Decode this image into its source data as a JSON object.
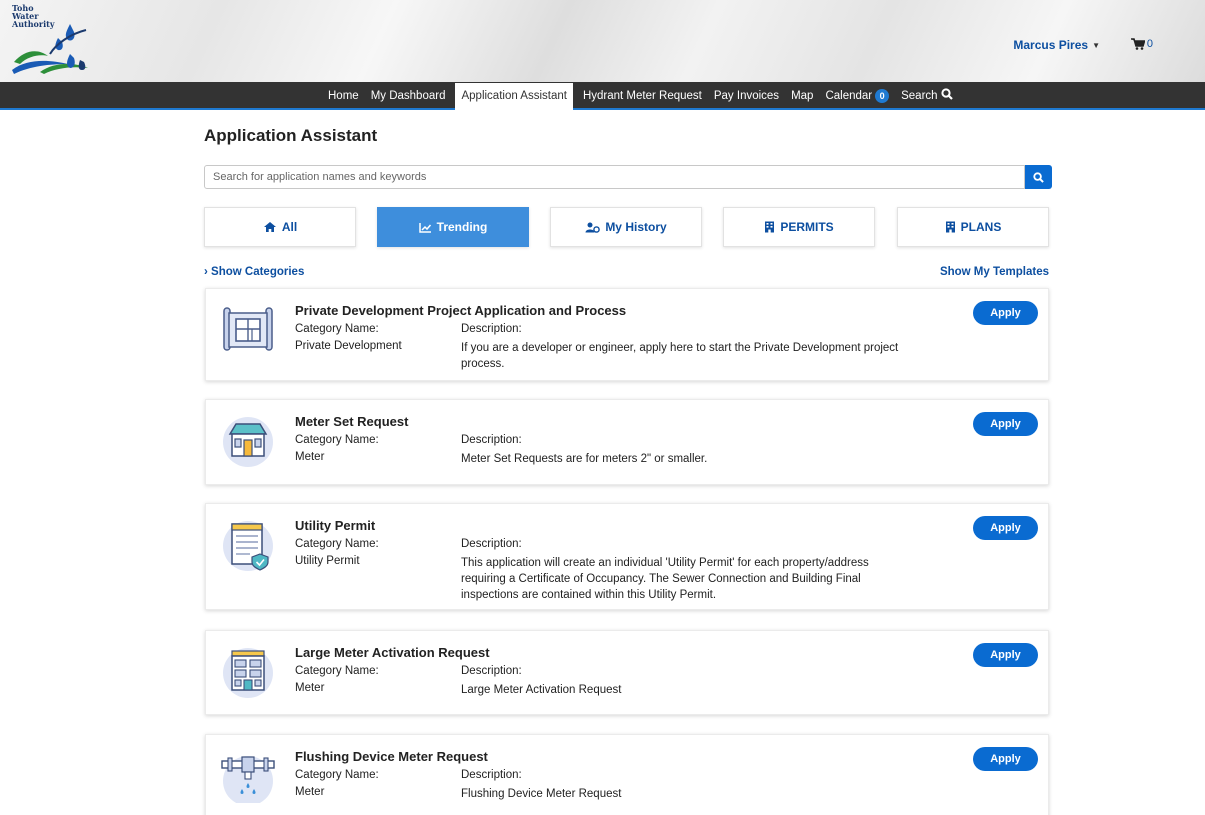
{
  "header": {
    "logo_text": [
      "Toho",
      "Water",
      "Authority"
    ],
    "user_name": "Marcus Pires",
    "cart_count": "0"
  },
  "nav": {
    "items": [
      {
        "label": "Home"
      },
      {
        "label": "My Dashboard"
      },
      {
        "label": "Application Assistant"
      },
      {
        "label": "Hydrant Meter Request"
      },
      {
        "label": "Pay Invoices"
      },
      {
        "label": "Map"
      },
      {
        "label": "Calendar"
      },
      {
        "label": "Search"
      }
    ],
    "calendar_badge": "0",
    "active": "Application Assistant"
  },
  "page": {
    "title": "Application Assistant",
    "search_placeholder": "Search for application names and keywords",
    "tabs": [
      {
        "label": "All",
        "icon": "home-icon"
      },
      {
        "label": "Trending",
        "icon": "chart-icon"
      },
      {
        "label": "My History",
        "icon": "users-icon"
      },
      {
        "label": "PERMITS",
        "icon": "building-icon"
      },
      {
        "label": "PLANS",
        "icon": "building-icon"
      }
    ],
    "active_tab": "Trending",
    "show_categories": "Show Categories",
    "show_templates": "Show My Templates"
  },
  "labels": {
    "category": "Category Name:",
    "description": "Description:",
    "apply": "Apply"
  },
  "applications": [
    {
      "title": "Private Development Project Application and Process",
      "category": "Private Development",
      "description": "If you are a developer or engineer, apply here to start the Private Development project process.",
      "icon": "blueprint-icon"
    },
    {
      "title": "Meter Set Request",
      "category": "Meter",
      "description": "Meter Set Requests are for meters 2\" or smaller.",
      "icon": "house-icon"
    },
    {
      "title": "Utility Permit",
      "category": "Utility Permit",
      "description": "This application will create an individual 'Utility Permit' for each property/address requiring a Certificate of Occupancy. The Sewer Connection and Building Final inspections are contained within this Utility Permit.",
      "icon": "document-check-icon"
    },
    {
      "title": "Large Meter Activation Request",
      "category": "Meter",
      "description": "Large Meter Activation Request",
      "icon": "office-building-icon"
    },
    {
      "title": "Flushing Device Meter Request",
      "category": "Meter",
      "description": "Flushing Device Meter Request",
      "icon": "pipe-valve-icon"
    }
  ],
  "colors": {
    "brand_blue": "#0a6bd1",
    "nav_bg": "#333333",
    "link_blue": "#0d4fa0",
    "active_tab": "#3e8edc"
  }
}
